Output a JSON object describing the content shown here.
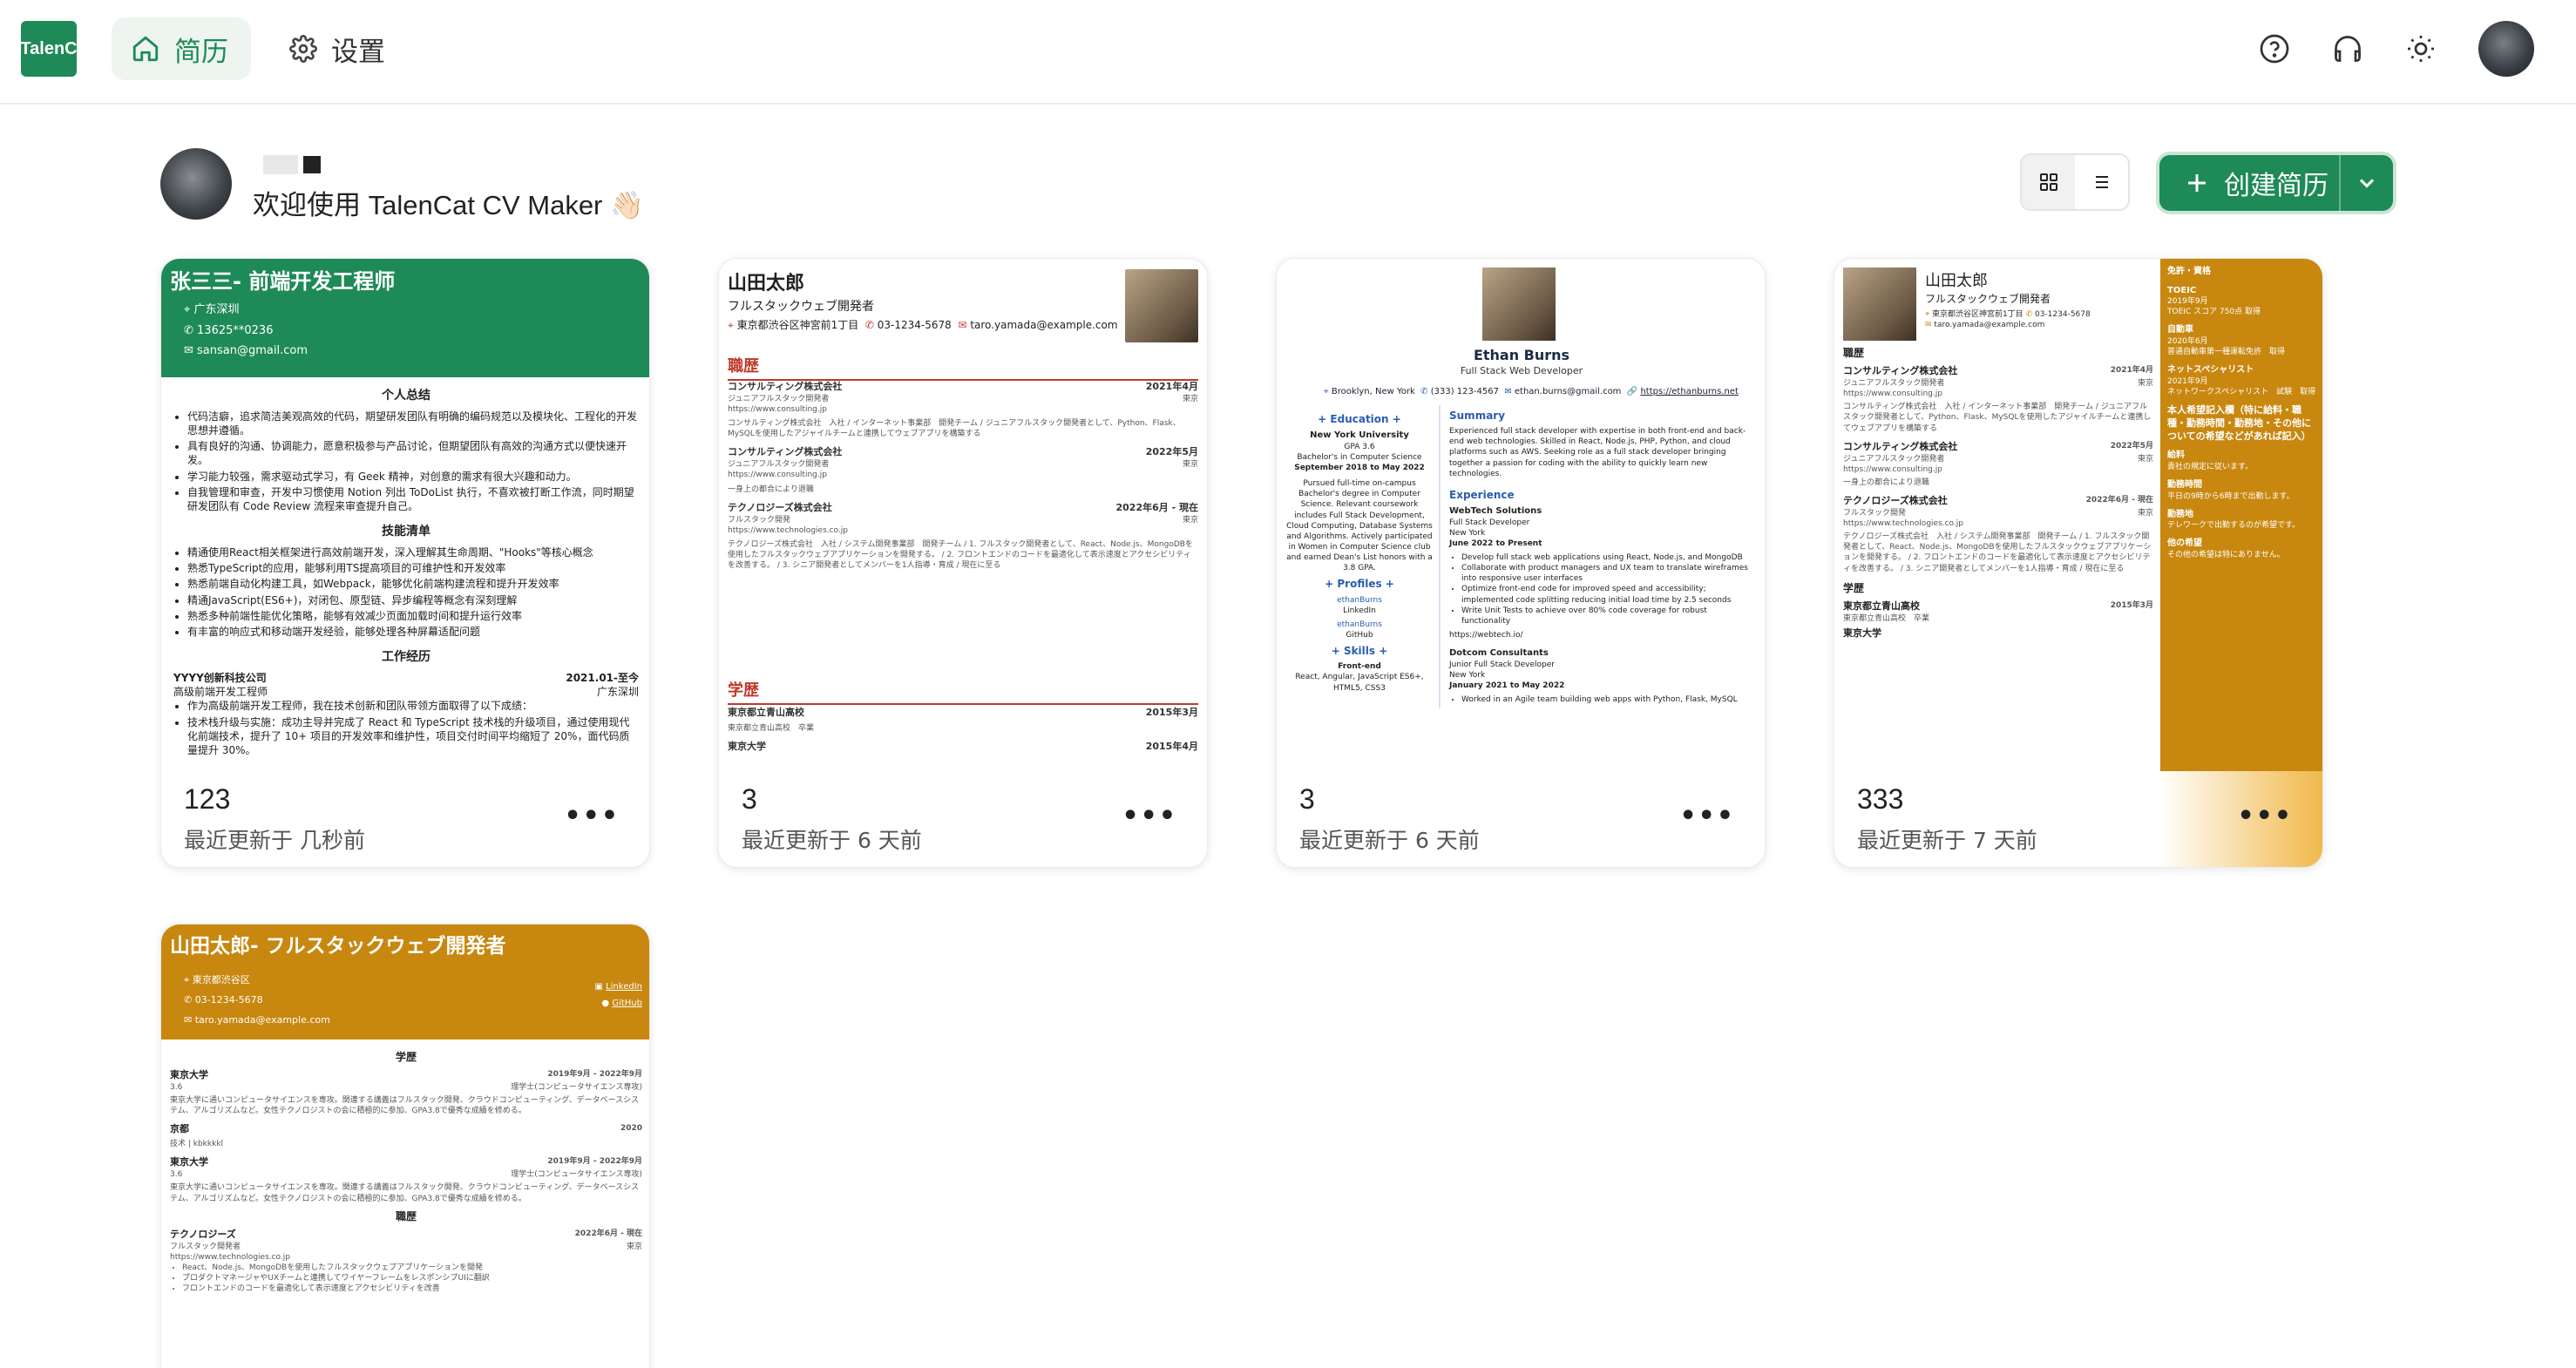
{
  "app": {
    "logo_text": "TalenC",
    "nav": {
      "resume_label": "简历",
      "settings_label": "设置"
    }
  },
  "welcome": {
    "text": "欢迎使用 TalenCat CV Maker 👋🏻"
  },
  "toolbar": {
    "create_label": "创建简历"
  },
  "cards": [
    {
      "count": "123",
      "updated": "最近更新于 几秒前",
      "preview": {
        "title": "张三三- 前端开发工程师",
        "location": "广东深圳",
        "phone": "13625**0236",
        "email": "sansan@gmail.com",
        "sec_summary": "个人总结",
        "summary_items": [
          "代码洁癖，追求简洁美观高效的代码，期望研发团队有明确的编码规范以及模块化、工程化的开发思想并遵循。",
          "具有良好的沟通、协调能力，愿意积极参与产品讨论，但期望团队有高效的沟通方式以便快速开发。",
          "学习能力较强，需求驱动式学习，有 Geek 精神，对创意的需求有很大兴趣和动力。",
          "自我管理和审查，开发中习惯使用 Notion 列出 ToDoList 执行，不喜欢被打断工作流，同时期望研发团队有 Code Review 流程来审查提升自己。"
        ],
        "sec_skills": "技能清单",
        "skill_items": [
          "精通使用React相关框架进行高效前端开发，深入理解其生命周期、\"Hooks\"等核心概念",
          "熟悉TypeScript的应用，能够利用TS提高项目的可维护性和开发效率",
          "熟悉前端自动化构建工具，如Webpack，能够优化前端构建流程和提升开发效率",
          "精通JavaScript(ES6+)，对闭包、原型链、异步编程等概念有深刻理解",
          "熟悉多种前端性能优化策略，能够有效减少页面加载时间和提升运行效率",
          "有丰富的响应式和移动端开发经验，能够处理各种屏幕适配问题"
        ],
        "sec_work": "工作经历",
        "company": "YYYY创新科技公司",
        "company_date": "2021.01-至今",
        "position": "高级前端开发工程师",
        "position_loc": "广东深圳",
        "work_items": [
          "作为高级前端开发工程师，我在技术创新和团队带领方面取得了以下成绩：",
          "技术栈升级与实施：成功主导并完成了 React 和 TypeScript 技术栈的升级项目，通过使用现代化前端技术，提升了 10+ 项目的开发效率和维护性，项目交付时间平均缩短了 20%，面代码质量提升 30%。"
        ]
      }
    },
    {
      "count": "3",
      "updated": "最近更新于 6 天前",
      "preview": {
        "name": "山田太郎",
        "role": "フルスタックウェブ開発者",
        "address": "東京都渋谷区神宮前1丁目",
        "phone": "03-1234-5678",
        "email": "taro.yamada@example.com",
        "sec_work": "職歴",
        "jobs": [
          {
            "company": "コンサルティング株式会社",
            "date": "2021年4月",
            "role": "ジュニアフルスタック開発者",
            "loc": "東京",
            "url": "https://www.consulting.jp",
            "detail": "コンサルティング株式会社　入社 / インターネット事業部　開発チーム / ジュニアフルスタック開発者として、Python、Flask、MySQLを使用したアジャイルチームと連携してウェブアプリを構築する"
          },
          {
            "company": "コンサルティング株式会社",
            "date": "2022年5月",
            "role": "ジュニアフルスタック開発者",
            "loc": "東京",
            "url": "https://www.consulting.jp",
            "detail": "一身上の都合により退職"
          },
          {
            "company": "テクノロジーズ株式会社",
            "date": "2022年6月 - 現在",
            "role": "フルスタック開発",
            "loc": "東京",
            "url": "https://www.technologies.co.jp",
            "detail": "テクノロジーズ株式会社　入社 / システム開発事業部　開発チーム / 1. フルスタック開発者として、React、Node.js、MongoDBを使用したフルスタックウェブアプリケーションを開発する。 / 2. フロントエンドのコードを最適化して表示速度とアクセシビリティを改善する。 / 3. シニア開発者としてメンバーを1人指導・育成 / 現在に至る"
          }
        ],
        "sec_edu": "学歴",
        "schools": [
          {
            "name": "東京都立青山高校",
            "date": "2015年3月",
            "detail": "東京都立青山高校　卒業"
          },
          {
            "name": "東京大学",
            "date": "2015年4月",
            "detail": ""
          }
        ]
      }
    },
    {
      "count": "3",
      "updated": "最近更新于 6 天前",
      "preview": {
        "name": "Ethan Burns",
        "role": "Full Stack Web Developer",
        "location": "Brooklyn, New York",
        "phone": "(333) 123-4567",
        "email": "ethan.burns@gmail.com",
        "site": "https://ethanburns.net",
        "sec_education": "Education",
        "university": "New York University",
        "gpa": "GPA 3.6",
        "degree": "Bachelor's in Computer Science",
        "dates": "September 2018 to May 2022",
        "edu_detail": "Pursued full-time on-campus Bachelor's degree in Computer Science. Relevant coursework includes Full Stack Development, Cloud Computing, Database Systems and Algorithms. Actively participated in Women in Computer Science club and earned Dean's List honors with a 3.8 GPA.",
        "sec_profiles": "Profiles",
        "profile1_handle": "ethanBurns",
        "profile1_site": "LinkedIn",
        "profile2_handle": "ethanBurns",
        "profile2_site": "GitHub",
        "sec_skills": "Skills",
        "skill_group": "Front-end",
        "skill_list": "React, Angular, JavaScript ES6+, HTML5, CSS3",
        "sec_summary": "Summary",
        "summary": "Experienced full stack developer with expertise in both front-end and back-end web technologies. Skilled in React, Node.js, PHP, Python, and cloud platforms such as AWS. Seeking role as a full stack developer bringing together a passion for coding with the ability to quickly learn new technologies.",
        "sec_experience": "Experience",
        "job1_company": "WebTech Solutions",
        "job1_role": "Full Stack Developer",
        "job1_loc": "New York",
        "job1_date": "June 2022 to Present",
        "job1_items": [
          "Develop full stack web applications using React, Node.js, and MongoDB",
          "Collaborate with product managers and UX team to translate wireframes into responsive user interfaces",
          "Optimize front-end code for improved speed and accessibility; implemented code splitting reducing initial load time by 2.5 seconds",
          "Write Unit Tests to achieve over 80% code coverage for robust functionality"
        ],
        "job1_url": "https://webtech.io/",
        "job2_company": "Dotcom Consultants",
        "job2_role": "Junior Full Stack Developer",
        "job2_loc": "New York",
        "job2_date": "January 2021 to May 2022",
        "job2_items": [
          "Worked in an Agile team building web apps with Python, Flask, MySQL"
        ]
      }
    },
    {
      "count": "333",
      "updated": "最近更新于 7 天前",
      "preview": {
        "name": "山田太郎",
        "role": "フルスタックウェブ開発者",
        "address": "東京都渋谷区神宮前1丁目",
        "phone": "03-1234-5678",
        "email": "taro.yamada@example.com",
        "sec_work": "職歴",
        "job1_company": "コンサルティング株式会社",
        "job1_date": "2021年4月",
        "job1_role": "ジュニアフルスタック開発者",
        "job1_loc": "東京",
        "job1_url": "https://www.consulting.jp",
        "job1_detail": "コンサルティング株式会社　入社 / インターネット事業部　開発チーム / ジュニアフルスタック開発者として、Python、Flask、MySQLを使用したアジャイルチームと連携してウェブアプリを構築する",
        "job2_company": "コンサルティング株式会社",
        "job2_date": "2022年5月",
        "job2_role": "ジュニアフルスタック開発者",
        "job2_loc": "東京",
        "job2_url": "https://www.consulting.jp",
        "job2_detail": "一身上の都合により退職",
        "job3_company": "テクノロジーズ株式会社",
        "job3_date": "2022年6月 - 現在",
        "job3_role": "フルスタック開発",
        "job3_loc": "東京",
        "job3_url": "https://www.technologies.co.jp",
        "job3_detail": "テクノロジーズ株式会社　入社 / システム開発事業部　開発チーム / 1. フルスタック開発者として、React、Node.js、MongoDBを使用したフルスタックウェブアプリケーションを開発する。 / 2. フロントエンドのコードを最適化して表示速度とアクセシビリティを改善する。 / 3. シニア開発者としてメンバーを1人指導・育成 / 現在に至る",
        "sec_edu": "学歴",
        "school": "東京都立青山高校",
        "school_date": "2015年3月",
        "school_detail": "東京都立青山高校　卒業",
        "school2": "東京大学",
        "side_sec1": "免許・資格",
        "side_toeic": "TOEIC",
        "side_toeic_date": "2019年9月",
        "side_toeic_detail": "TOEIC スコア 750点 取得",
        "side_car": "自動車",
        "side_car_date": "2020年6月",
        "side_car_detail": "普通自動車第一種運転免許　取得",
        "side_net": "ネットスペシャリスト",
        "side_net_date": "2021年9月",
        "side_net_detail": "ネットワークスペシャリスト　試験　取得",
        "side_sec2": "本人希望記入欄（特に給料・職種・勤務時間・勤務地・その他についての希望などがあれば記入）",
        "side_salary": "給料",
        "side_salary_detail": "貴社の規定に従います。",
        "side_hours": "勤務時間",
        "side_hours_detail": "平日の9時から6時まで出勤します。",
        "side_place": "勤務地",
        "side_place_detail": "テレワークで出勤するのが希望です。",
        "side_other": "他の希望",
        "side_other_detail": "その他の希望は特にありません。"
      }
    },
    {
      "preview": {
        "title": "山田太郎- フルスタックウェブ開発者",
        "location": "東京都渋谷区",
        "phone": "03-1234-5678",
        "email": "taro.yamada@example.com",
        "link1": "LinkedIn",
        "link2": "GitHub",
        "sec_edu": "学歴",
        "edu1_name": "東京大学",
        "edu1_date": "2019年9月 - 2022年9月",
        "edu1_gpa": "3.6",
        "edu1_degree": "理学士(コンピュータサイエンス専攻)",
        "edu1_detail": "東京大学に通いコンピュータサイエンスを専攻。関連する講義はフルスタック開発、クラウドコンピューティング、データベースシステム、アルゴリズムなど。女性テクノロジストの会に積極的に参加、GPA3.8で優秀な成績を修める。",
        "edu2_name": "京都",
        "edu2_date": "2020",
        "edu2_detail": "技术 | kbkkkkl",
        "edu3_name": "東京大学",
        "edu3_date": "2019年9月 - 2022年9月",
        "edu3_gpa": "3.6",
        "edu3_degree": "理学士(コンピュータサイエンス専攻)",
        "edu3_detail": "東京大学に通いコンピュータサイエンスを専攻。関連する講義はフルスタック開発、クラウドコンピューティング、データベースシステム、アルゴリズムなど。女性テクノロジストの会に積極的に参加、GPA3.8で優秀な成績を修める。",
        "sec_work": "職歴",
        "job_company": "テクノロジーズ",
        "job_date": "2022年6月 - 現在",
        "job_role": "フルスタック開発者",
        "job_loc": "東京",
        "job_url": "https://www.technologies.co.jp",
        "job_items": [
          "React、Node.js、MongoDBを使用したフルスタックウェブアプリケーションを開発",
          "プロダクトマネージャやUXチームと連携してワイヤーフレームをレスポンシブUIに翻訳",
          "フロントエンドのコードを最適化して表示速度とアクセシビリティを改善"
        ]
      }
    }
  ],
  "colors": {
    "brand_green": "#1e8a57",
    "resume_orange": "#c8870f",
    "section_red": "#c0392b",
    "link_blue": "#2a5db0"
  },
  "icons": {
    "nav_resume": "home-icon",
    "nav_settings": "gear-icon",
    "help": "help-circle-icon",
    "support": "headphones-icon",
    "theme": "sun-icon",
    "grid": "grid-view-icon",
    "list": "list-view-icon",
    "create": "plus-icon",
    "dropdown": "chevron-down-icon",
    "more": "more-horizontal-icon"
  }
}
